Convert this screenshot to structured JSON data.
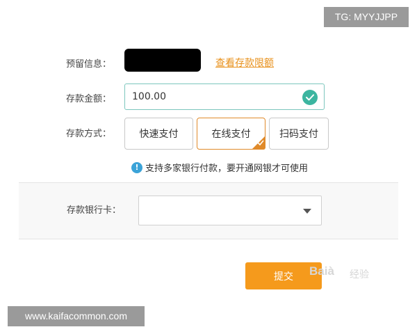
{
  "watermarks": {
    "tg": "TG: MYYJJPP",
    "site": "www.kaifacommon.com",
    "baidu_logo": "Baià",
    "jingyan": "经验"
  },
  "form": {
    "reserved_info_label": "预留信息：",
    "view_limit_link": "查看存款限额",
    "amount_label": "存款金额：",
    "amount_value": "100.00",
    "method_label": "存款方式：",
    "methods": [
      "快速支付",
      "在线支付",
      "扫码支付"
    ],
    "selected_method": "在线支付",
    "notice": "支持多家银行付款，要开通网银才可使用",
    "bank_card_label": "存款银行卡：",
    "bank_card_value": "",
    "submit_label": "提交"
  },
  "colors": {
    "accent_orange": "#f59a1c",
    "selected_border": "#e08a2a",
    "link_orange": "#e8901a",
    "check_teal": "#3cb5a0",
    "info_blue": "#3ba3d8"
  }
}
